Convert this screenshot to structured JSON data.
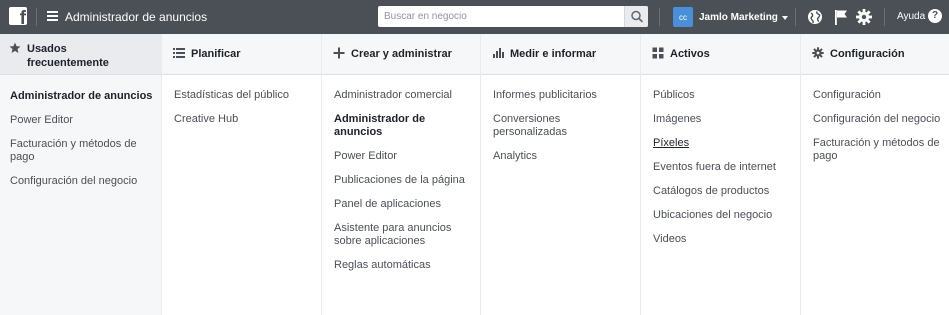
{
  "topbar": {
    "logo_letter": "f",
    "app_title": "Administrador de anuncios",
    "search_placeholder": "Buscar en negocio",
    "account_initials": "cc",
    "account_name": "Jamlo Marketing",
    "help_label": "Ayuda",
    "help_icon_glyph": "?"
  },
  "columns": [
    {
      "icon": "star-icon",
      "title": "Usados frecuentemente",
      "items": [
        {
          "label": "Administrador de anuncios",
          "state": "active"
        },
        {
          "label": "Power Editor",
          "state": "normal"
        },
        {
          "label": "Facturación y métodos de pago",
          "state": "normal"
        },
        {
          "label": "Configuración del negocio",
          "state": "normal"
        }
      ]
    },
    {
      "icon": "list-icon",
      "title": "Planificar",
      "items": [
        {
          "label": "Estadísticas del público",
          "state": "normal"
        },
        {
          "label": "Creative Hub",
          "state": "normal"
        }
      ]
    },
    {
      "icon": "plus-icon",
      "title": "Crear y administrar",
      "items": [
        {
          "label": "Administrador comercial",
          "state": "normal"
        },
        {
          "label": "Administrador de anuncios",
          "state": "active"
        },
        {
          "label": "Power Editor",
          "state": "normal"
        },
        {
          "label": "Publicaciones de la página",
          "state": "normal"
        },
        {
          "label": "Panel de aplicaciones",
          "state": "normal"
        },
        {
          "label": "Asistente para anuncios sobre aplicaciones",
          "state": "normal"
        },
        {
          "label": "Reglas automáticas",
          "state": "normal"
        }
      ]
    },
    {
      "icon": "bar-chart-icon",
      "title": "Medir e informar",
      "items": [
        {
          "label": "Informes publicitarios",
          "state": "normal"
        },
        {
          "label": "Conversiones personalizadas",
          "state": "normal"
        },
        {
          "label": "Analytics",
          "state": "normal"
        }
      ]
    },
    {
      "icon": "grid-icon",
      "title": "Activos",
      "items": [
        {
          "label": "Públicos",
          "state": "normal"
        },
        {
          "label": "Imágenes",
          "state": "normal"
        },
        {
          "label": "Píxeles",
          "state": "hover"
        },
        {
          "label": "Eventos fuera de internet",
          "state": "normal"
        },
        {
          "label": "Catálogos de productos",
          "state": "normal"
        },
        {
          "label": "Ubicaciones del negocio",
          "state": "normal"
        },
        {
          "label": "Videos",
          "state": "normal"
        }
      ]
    },
    {
      "icon": "gear-icon",
      "title": "Configuración",
      "items": [
        {
          "label": "Configuración",
          "state": "normal"
        },
        {
          "label": "Configuración del negocio",
          "state": "normal"
        },
        {
          "label": "Facturación y métodos de pago",
          "state": "normal"
        }
      ]
    }
  ],
  "colors": {
    "topbar_bg": "#4b4f56",
    "column_header_bg": "#f6f7f9",
    "first_column_bg": "#f6f7f9",
    "active_text": "#1d2129",
    "item_text": "#4b4f56"
  }
}
